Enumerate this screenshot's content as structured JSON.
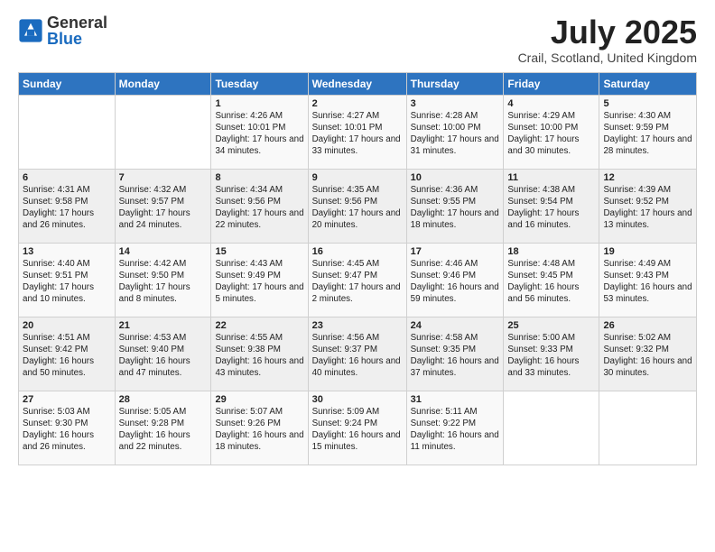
{
  "logo": {
    "general": "General",
    "blue": "Blue"
  },
  "title": "July 2025",
  "subtitle": "Crail, Scotland, United Kingdom",
  "days_of_week": [
    "Sunday",
    "Monday",
    "Tuesday",
    "Wednesday",
    "Thursday",
    "Friday",
    "Saturday"
  ],
  "weeks": [
    [
      {
        "day": "",
        "info": ""
      },
      {
        "day": "",
        "info": ""
      },
      {
        "day": "1",
        "info": "Sunrise: 4:26 AM\nSunset: 10:01 PM\nDaylight: 17 hours and 34 minutes."
      },
      {
        "day": "2",
        "info": "Sunrise: 4:27 AM\nSunset: 10:01 PM\nDaylight: 17 hours and 33 minutes."
      },
      {
        "day": "3",
        "info": "Sunrise: 4:28 AM\nSunset: 10:00 PM\nDaylight: 17 hours and 31 minutes."
      },
      {
        "day": "4",
        "info": "Sunrise: 4:29 AM\nSunset: 10:00 PM\nDaylight: 17 hours and 30 minutes."
      },
      {
        "day": "5",
        "info": "Sunrise: 4:30 AM\nSunset: 9:59 PM\nDaylight: 17 hours and 28 minutes."
      }
    ],
    [
      {
        "day": "6",
        "info": "Sunrise: 4:31 AM\nSunset: 9:58 PM\nDaylight: 17 hours and 26 minutes."
      },
      {
        "day": "7",
        "info": "Sunrise: 4:32 AM\nSunset: 9:57 PM\nDaylight: 17 hours and 24 minutes."
      },
      {
        "day": "8",
        "info": "Sunrise: 4:34 AM\nSunset: 9:56 PM\nDaylight: 17 hours and 22 minutes."
      },
      {
        "day": "9",
        "info": "Sunrise: 4:35 AM\nSunset: 9:56 PM\nDaylight: 17 hours and 20 minutes."
      },
      {
        "day": "10",
        "info": "Sunrise: 4:36 AM\nSunset: 9:55 PM\nDaylight: 17 hours and 18 minutes."
      },
      {
        "day": "11",
        "info": "Sunrise: 4:38 AM\nSunset: 9:54 PM\nDaylight: 17 hours and 16 minutes."
      },
      {
        "day": "12",
        "info": "Sunrise: 4:39 AM\nSunset: 9:52 PM\nDaylight: 17 hours and 13 minutes."
      }
    ],
    [
      {
        "day": "13",
        "info": "Sunrise: 4:40 AM\nSunset: 9:51 PM\nDaylight: 17 hours and 10 minutes."
      },
      {
        "day": "14",
        "info": "Sunrise: 4:42 AM\nSunset: 9:50 PM\nDaylight: 17 hours and 8 minutes."
      },
      {
        "day": "15",
        "info": "Sunrise: 4:43 AM\nSunset: 9:49 PM\nDaylight: 17 hours and 5 minutes."
      },
      {
        "day": "16",
        "info": "Sunrise: 4:45 AM\nSunset: 9:47 PM\nDaylight: 17 hours and 2 minutes."
      },
      {
        "day": "17",
        "info": "Sunrise: 4:46 AM\nSunset: 9:46 PM\nDaylight: 16 hours and 59 minutes."
      },
      {
        "day": "18",
        "info": "Sunrise: 4:48 AM\nSunset: 9:45 PM\nDaylight: 16 hours and 56 minutes."
      },
      {
        "day": "19",
        "info": "Sunrise: 4:49 AM\nSunset: 9:43 PM\nDaylight: 16 hours and 53 minutes."
      }
    ],
    [
      {
        "day": "20",
        "info": "Sunrise: 4:51 AM\nSunset: 9:42 PM\nDaylight: 16 hours and 50 minutes."
      },
      {
        "day": "21",
        "info": "Sunrise: 4:53 AM\nSunset: 9:40 PM\nDaylight: 16 hours and 47 minutes."
      },
      {
        "day": "22",
        "info": "Sunrise: 4:55 AM\nSunset: 9:38 PM\nDaylight: 16 hours and 43 minutes."
      },
      {
        "day": "23",
        "info": "Sunrise: 4:56 AM\nSunset: 9:37 PM\nDaylight: 16 hours and 40 minutes."
      },
      {
        "day": "24",
        "info": "Sunrise: 4:58 AM\nSunset: 9:35 PM\nDaylight: 16 hours and 37 minutes."
      },
      {
        "day": "25",
        "info": "Sunrise: 5:00 AM\nSunset: 9:33 PM\nDaylight: 16 hours and 33 minutes."
      },
      {
        "day": "26",
        "info": "Sunrise: 5:02 AM\nSunset: 9:32 PM\nDaylight: 16 hours and 30 minutes."
      }
    ],
    [
      {
        "day": "27",
        "info": "Sunrise: 5:03 AM\nSunset: 9:30 PM\nDaylight: 16 hours and 26 minutes."
      },
      {
        "day": "28",
        "info": "Sunrise: 5:05 AM\nSunset: 9:28 PM\nDaylight: 16 hours and 22 minutes."
      },
      {
        "day": "29",
        "info": "Sunrise: 5:07 AM\nSunset: 9:26 PM\nDaylight: 16 hours and 18 minutes."
      },
      {
        "day": "30",
        "info": "Sunrise: 5:09 AM\nSunset: 9:24 PM\nDaylight: 16 hours and 15 minutes."
      },
      {
        "day": "31",
        "info": "Sunrise: 5:11 AM\nSunset: 9:22 PM\nDaylight: 16 hours and 11 minutes."
      },
      {
        "day": "",
        "info": ""
      },
      {
        "day": "",
        "info": ""
      }
    ]
  ]
}
